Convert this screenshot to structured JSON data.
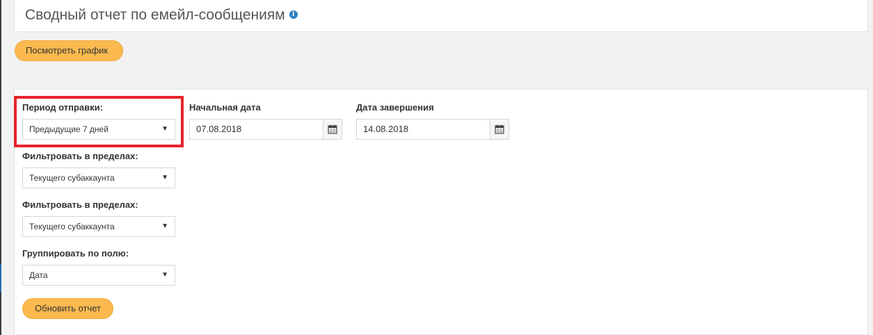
{
  "page": {
    "title": "Сводный отчет по емейл-сообщениям",
    "info_icon": "info-icon"
  },
  "toolbar": {
    "view_chart_label": "Посмотреть график"
  },
  "filters": {
    "period": {
      "label": "Период отправки:",
      "value": "Предыдущие 7 дней"
    },
    "start_date": {
      "label": "Начальная дата",
      "value": "07.08.2018"
    },
    "end_date": {
      "label": "Дата завершения",
      "value": "14.08.2018"
    },
    "filter_within_1": {
      "label": "Фильтровать в пределах:",
      "value": "Текущего субаккаунта"
    },
    "filter_within_2": {
      "label": "Фильтровать в пределах:",
      "value": "Текущего субаккаунта"
    },
    "group_by": {
      "label": "Группировать по полю:",
      "value": "Дата"
    },
    "refresh_label": "Обновить отчет"
  },
  "colors": {
    "accent": "#fbb94f",
    "highlight": "#e8242b",
    "info": "#2a7fc1"
  }
}
